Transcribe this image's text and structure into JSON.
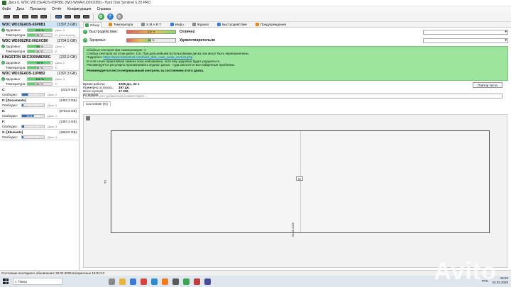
{
  "window": {
    "title": "Диск 0, WDC WD15EADS-65P8B1 (WD-WMAVU0263080) - Hard Disk Sentinel 6.20 PRO"
  },
  "menu": [
    "Файл",
    "Диск",
    "Просмотр",
    "Отчёт",
    "Конфигурация",
    "Справка"
  ],
  "disks": [
    {
      "name": "WDC WD15EADS-65P8B1",
      "capacity": "(1397,3 GB)",
      "health_label": "Здоровье:",
      "health": "100 %",
      "health_pct": 100,
      "temp_label": "Температура:",
      "temp": "33 °C",
      "side_health": "Диск: 0",
      "side_temp": "D: [Documents]"
    },
    {
      "name": "WDC WD30EZRZ-00GXCB0",
      "capacity": "(2794,5 GB)",
      "health_label": "Здоровье:",
      "health": "50 %",
      "health_pct": 50,
      "temp_label": "Температура:",
      "temp": "33 °C",
      "side_health": "Диск: 1",
      "side_temp": "E:"
    },
    {
      "name": "KINGSTON SKC2000M8250G",
      "capacity": "(232,9 GB)",
      "health_label": "Здоровье:",
      "health": "94 %",
      "health_pct": 94,
      "temp_label": "Температура:",
      "temp": "34 °C",
      "side_health": "Диск: 2",
      "side_temp": "C:"
    },
    {
      "name": "WDC WD15EADS-11P8B2",
      "capacity": "(1397,3 GB)",
      "health_label": "Здоровье:",
      "health": "100 %",
      "health_pct": 100,
      "temp_label": "Температура:",
      "temp": "33 °C",
      "side_health": "Диск: 3",
      "side_temp": "F:"
    }
  ],
  "partitions": [
    {
      "name": "C:",
      "size": "(232,9 GB)",
      "free_label": "Свободно:",
      "free": "65,7 GB",
      "free_pct": 28,
      "disk": "Диск: 2"
    },
    {
      "name": "D: [Documents]",
      "size": "(1397,3 GB)",
      "free_label": "Свободно:",
      "free": "112,4 GB",
      "free_pct": 8,
      "disk": "Диск: 0"
    },
    {
      "name": "E:",
      "size": "(2794,5 GB)",
      "free_label": "Свободно:",
      "free": "1511,3 GB",
      "free_pct": 54,
      "disk": "Диск: 1"
    },
    {
      "name": "F:",
      "size": "(1397,3 GB)",
      "free_label": "Свободно:",
      "free": "118,7 GB",
      "free_pct": 9,
      "disk": "Диск: 3"
    },
    {
      "name": "G: [Elements]",
      "size": "(1863,0 GB)",
      "free_label": "Свободно:",
      "free": "145,8 GB",
      "free_pct": 8,
      "disk": "Диск: 4"
    }
  ],
  "tabs": [
    "Обзор",
    "Температура",
    "S.M.A.R.T.",
    "Инфо",
    "Журнал",
    "Быстродействие",
    "Предупреждения"
  ],
  "status": {
    "performance_label": "Быстродействие:",
    "performance": "100 %",
    "performance_text": "Отлично",
    "health_label": "Здоровье:",
    "health": "50 %",
    "health_text": "Удовлетворительно"
  },
  "info": {
    "line1": "Сбойных секторов при самопроверке: 4",
    "line2": "Слабых секторов на этом диске: 116. При дальнейшем использовании диска они могут быть переназначены.",
    "line3_prefix": "Подробно: ",
    "line3_link": "https://www.hdsentinel.com/hard_disk_case_weak_sectors.php",
    "line4": "В этой точке гарантийная замена пока невозможна, хотя ему здоровье будет ухудшаться.",
    "line5": "Рекомендуется регулярно просматривать журнал диска - туда заносятся все найденные проблемы.",
    "line6": "Рекомендуется вести непрерывный контроль за состоянием этого диска."
  },
  "stats": {
    "worktime_label": "Время работы:",
    "worktime": "1036 дн., 22 ч",
    "remaining_label": "Примерно осталось:",
    "remaining": "197 дн.",
    "starts_label": "Всего пусков/остановок:",
    "starts": "17 036",
    "retest_button": "Повтор теста"
  },
  "comment_placeholder": "Нажмите для добавления комментария ...",
  "chart": {
    "tab": "Состояние (%)",
    "point_value": "50",
    "y_label": "50",
    "x_label": "23.02.2025"
  },
  "statusbar": "Состояние последнего обновления: 23.02.2025 воскресенье 15:04:13",
  "taskbar": {
    "search": "Поиск",
    "lang": "РУС",
    "time": "15:04",
    "date": "23.02.2025"
  },
  "watermark": "Avito",
  "colors": {
    "ok_green": "#3aa650",
    "info_bg": "#9de49d",
    "bar_green": "#58d468",
    "bar_blue": "#2d6fb6"
  }
}
